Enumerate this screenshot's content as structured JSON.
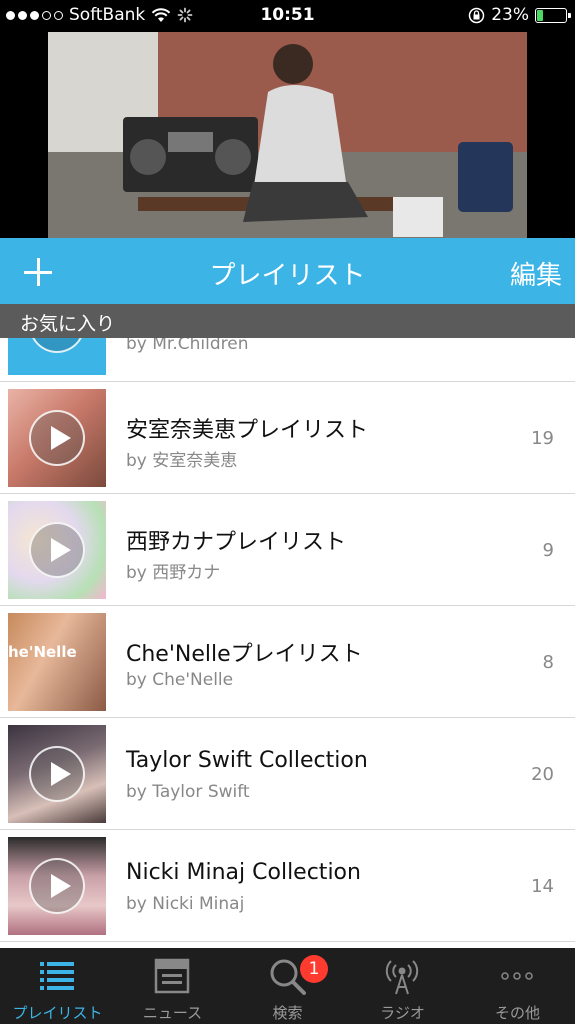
{
  "status_bar": {
    "carrier": "SoftBank",
    "time": "10:51",
    "battery_percent": "23%",
    "battery_level": 0.23
  },
  "header": {
    "title": "プレイリスト",
    "edit_label": "編集"
  },
  "section": {
    "label": "お気に入り"
  },
  "playlists": [
    {
      "title": "",
      "by": "by Mr.Children",
      "count": ""
    },
    {
      "title": "安室奈美恵プレイリスト",
      "by": "by 安室奈美恵",
      "count": "19"
    },
    {
      "title": "西野カナプレイリスト",
      "by": "by 西野カナ",
      "count": "9"
    },
    {
      "title": "Che'Nelleプレイリスト",
      "by": "by Che'Nelle",
      "count": "8"
    },
    {
      "title": "Taylor Swift Collection",
      "by": "by Taylor Swift",
      "count": "20"
    },
    {
      "title": "Nicki Minaj Collection",
      "by": "by Nicki Minaj",
      "count": "14"
    }
  ],
  "tabs": [
    {
      "label": "プレイリスト",
      "icon": "list-icon",
      "active": true
    },
    {
      "label": "ニュース",
      "icon": "news-icon",
      "active": false
    },
    {
      "label": "検索",
      "icon": "search-icon",
      "active": false,
      "badge": "1"
    },
    {
      "label": "ラジオ",
      "icon": "radio-icon",
      "active": false
    },
    {
      "label": "その他",
      "icon": "more-icon",
      "active": false
    }
  ],
  "colors": {
    "accent": "#3cb4e6",
    "section_bar": "#5b5b5b",
    "tab_bar": "#1e1e1e",
    "badge": "#ff3b30"
  }
}
